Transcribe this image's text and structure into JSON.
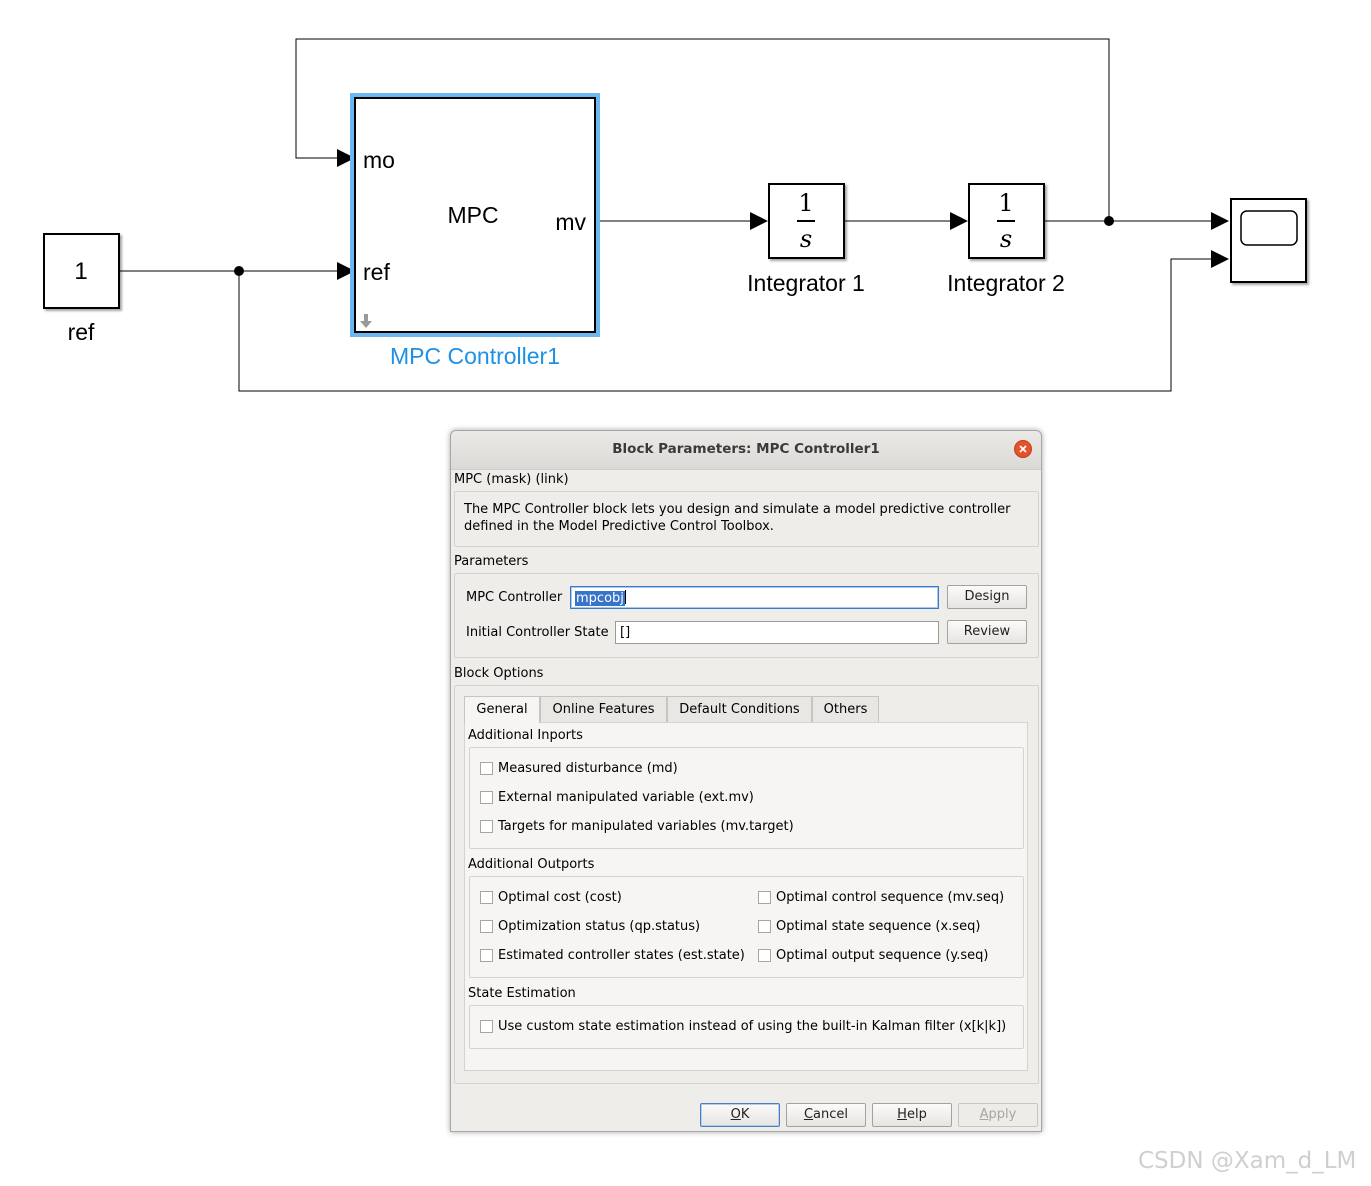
{
  "diagram": {
    "ref_block": {
      "value": "1",
      "name": "ref"
    },
    "mpc_block": {
      "title": "MPC",
      "ports_in": [
        "mo",
        "ref"
      ],
      "port_out": "mv",
      "name": "MPC Controller1"
    },
    "integrator1": {
      "numerator": "1",
      "denominator": "s",
      "name": "Integrator 1"
    },
    "integrator2": {
      "numerator": "1",
      "denominator": "s",
      "name": "Integrator 2"
    },
    "scope_block": {
      "icon": "scope-icon"
    },
    "colors": {
      "selected": "#1e90e6",
      "selected_outline": "#6ab8ee",
      "line": "#000000"
    }
  },
  "dialog": {
    "title": "Block Parameters: MPC Controller1",
    "mask_type": "MPC (mask) (link)",
    "description_line1": "The MPC Controller block lets you design and simulate a model predictive controller",
    "description_line2": "defined in the Model Predictive Control Toolbox.",
    "parameters_label": "Parameters",
    "mpc_controller_label": "MPC Controller",
    "mpc_controller_value": "mpcobj",
    "design_button": "Design",
    "initial_state_label": "Initial Controller State",
    "initial_state_value": "[]",
    "review_button": "Review",
    "block_options_label": "Block Options",
    "tabs": [
      "General",
      "Online Features",
      "Default Conditions",
      "Others"
    ],
    "active_tab": "General",
    "additional_inports": {
      "label": "Additional Inports",
      "items": [
        "Measured disturbance (md)",
        "External manipulated variable (ext.mv)",
        "Targets for manipulated variables (mv.target)"
      ]
    },
    "additional_outports": {
      "label": "Additional Outports",
      "left": [
        "Optimal cost (cost)",
        "Optimization status (qp.status)",
        "Estimated controller states (est.state)"
      ],
      "right": [
        "Optimal control sequence (mv.seq)",
        "Optimal state sequence (x.seq)",
        "Optimal output sequence (y.seq)"
      ]
    },
    "state_estimation": {
      "label": "State Estimation",
      "items": [
        "Use custom state estimation instead of using the built-in Kalman filter (x[k|k])"
      ]
    },
    "buttons": {
      "ok": {
        "prefix": "",
        "mnemonic": "O",
        "rest": "K"
      },
      "cancel": {
        "prefix": "",
        "mnemonic": "C",
        "rest": "ancel"
      },
      "help": {
        "prefix": "",
        "mnemonic": "H",
        "rest": "elp"
      },
      "apply": {
        "prefix": "",
        "mnemonic": "A",
        "rest": "pply"
      }
    }
  },
  "watermark": "CSDN @Xam_d_LM"
}
